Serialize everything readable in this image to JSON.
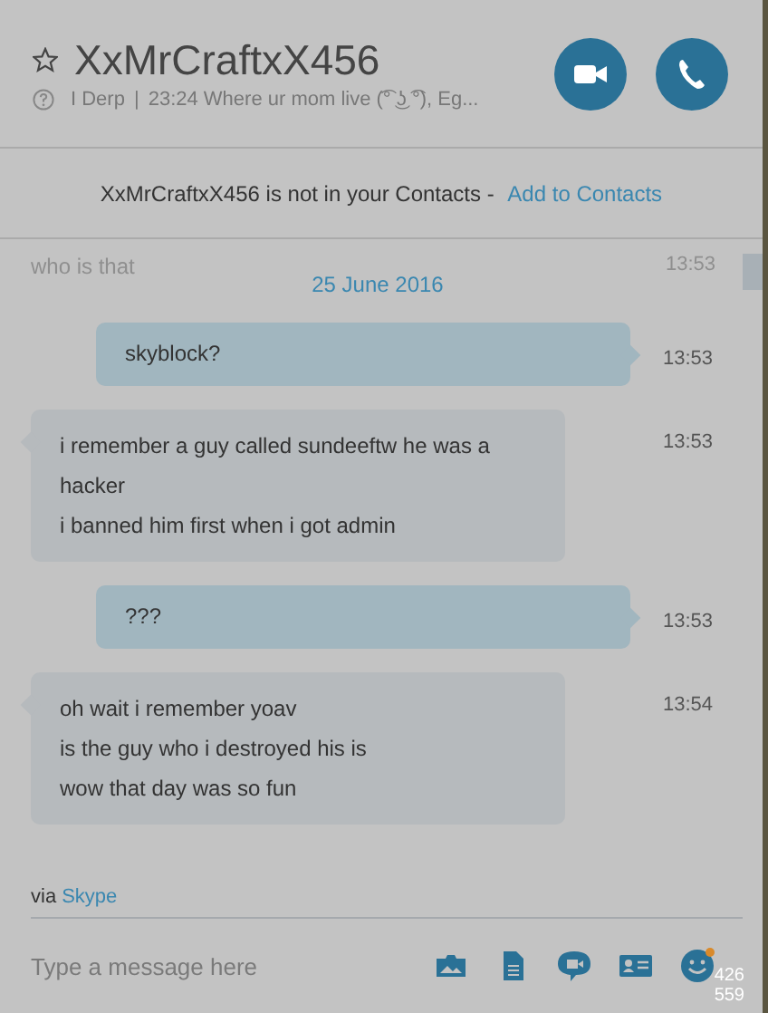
{
  "header": {
    "favorite": false,
    "name": "XxMrCraftxX456",
    "mood": "I Derp",
    "separator": "|",
    "status": "23:24 Where ur mom live (͡° ͜ʖ ͡°), Eg..."
  },
  "call_buttons": [
    {
      "kind": "video"
    },
    {
      "kind": "audio"
    }
  ],
  "notice": {
    "text": "XxMrCraftxX456 is not in your Contacts - ",
    "link": "Add to Contacts"
  },
  "faded_message": {
    "text": "who is that",
    "time": "13:53"
  },
  "date": "25 June 2016",
  "messages": [
    {
      "kind": "outgoing",
      "lines": [
        "skyblock?"
      ],
      "time": "13:53"
    },
    {
      "kind": "incoming",
      "lines": [
        "i remember a guy called sundeeftw he was a hacker",
        "i banned him first when i got admin"
      ],
      "time": "13:53"
    },
    {
      "kind": "outgoing",
      "lines": [
        "???"
      ],
      "time": "13:53"
    },
    {
      "kind": "incoming",
      "lines": [
        "oh wait i remember yoav",
        "is the guy who i destroyed his is",
        "wow that day was so fun"
      ],
      "time": "13:54"
    }
  ],
  "via": {
    "text": "via",
    "link": "Skype"
  },
  "composer": {
    "placeholder": "Type a message here",
    "tools": [
      {
        "kind": "media"
      },
      {
        "kind": "file"
      },
      {
        "kind": "video-message"
      },
      {
        "kind": "contact"
      },
      {
        "kind": "emoticon",
        "notify": true
      }
    ]
  },
  "overlay_text": [
    "426",
    "559"
  ]
}
